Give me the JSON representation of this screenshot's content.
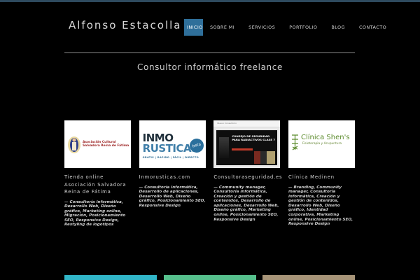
{
  "site": {
    "logo": "Alfonso Estacolla",
    "nav": [
      {
        "label": "INICIO",
        "active": true
      },
      {
        "label": "SOBRE MI",
        "active": false
      },
      {
        "label": "SERVICIOS",
        "active": false
      },
      {
        "label": "PORTFOLIO",
        "active": false
      },
      {
        "label": "BLOG",
        "active": false
      },
      {
        "label": "CONTACTO",
        "active": false
      }
    ],
    "tagline": "Consultor informático freelance"
  },
  "portfolio": [
    {
      "title": "Tienda online Asociación Salvadora Reina de Fátima",
      "desc": "— Consultoría informática, Desarrollo Web, Diseño gráfico, Marketing online, Migración, Posicionamiento SEO, Responsive Design, Restyling de logotipos",
      "thumb": {
        "org_line": "Asociación Cultural Salvadora Reina de Fátima"
      }
    },
    {
      "title": "Inmorusticas.com",
      "desc": "— Consultoría informática, Desarrollo de aplicaciones, Desarrollo Web, Diseño gráfico, Posicionamiento SEO, Responsive Design",
      "thumb": {
        "word1": "INMO",
        "word2": "RUSTICAS",
        "badge": "beta",
        "sub": "GRATIS | RAPIDO | FÁCIL | DIRECTO"
      }
    },
    {
      "title": "Consultoraseguridad.es",
      "desc": "— Community manager, Consultoría informática, Creación y gestión de contenidos, Desarrollo de aplicaciones, Desarrollo Web, Diseño gráfico, Marketing online, Posicionamiento SEO, Responsive Design",
      "thumb": {
        "header": "Nuevo Consultorio",
        "headline": "CONSEJO DE SEGURIDAD PARA RADIACTIVOS CLASE 7"
      }
    },
    {
      "title": "Clínica Medinen",
      "desc": "— Branding, Community manager, Consultoría informática, Creación y gestión de contenidos, Desarrollo Web, Diseño gráfico, Identidad corporativa, Marketing online, Posicionamiento SEO, Responsive Design",
      "thumb": {
        "name": "Clínica Shen's",
        "sub": "Fisioterapia y Acupuntura"
      }
    }
  ],
  "colors": {
    "nav_active": "#2f6f9a",
    "bottom_1": "#31b6c8",
    "bottom_2": "#56c08c",
    "bottom_3": "#a79478"
  }
}
